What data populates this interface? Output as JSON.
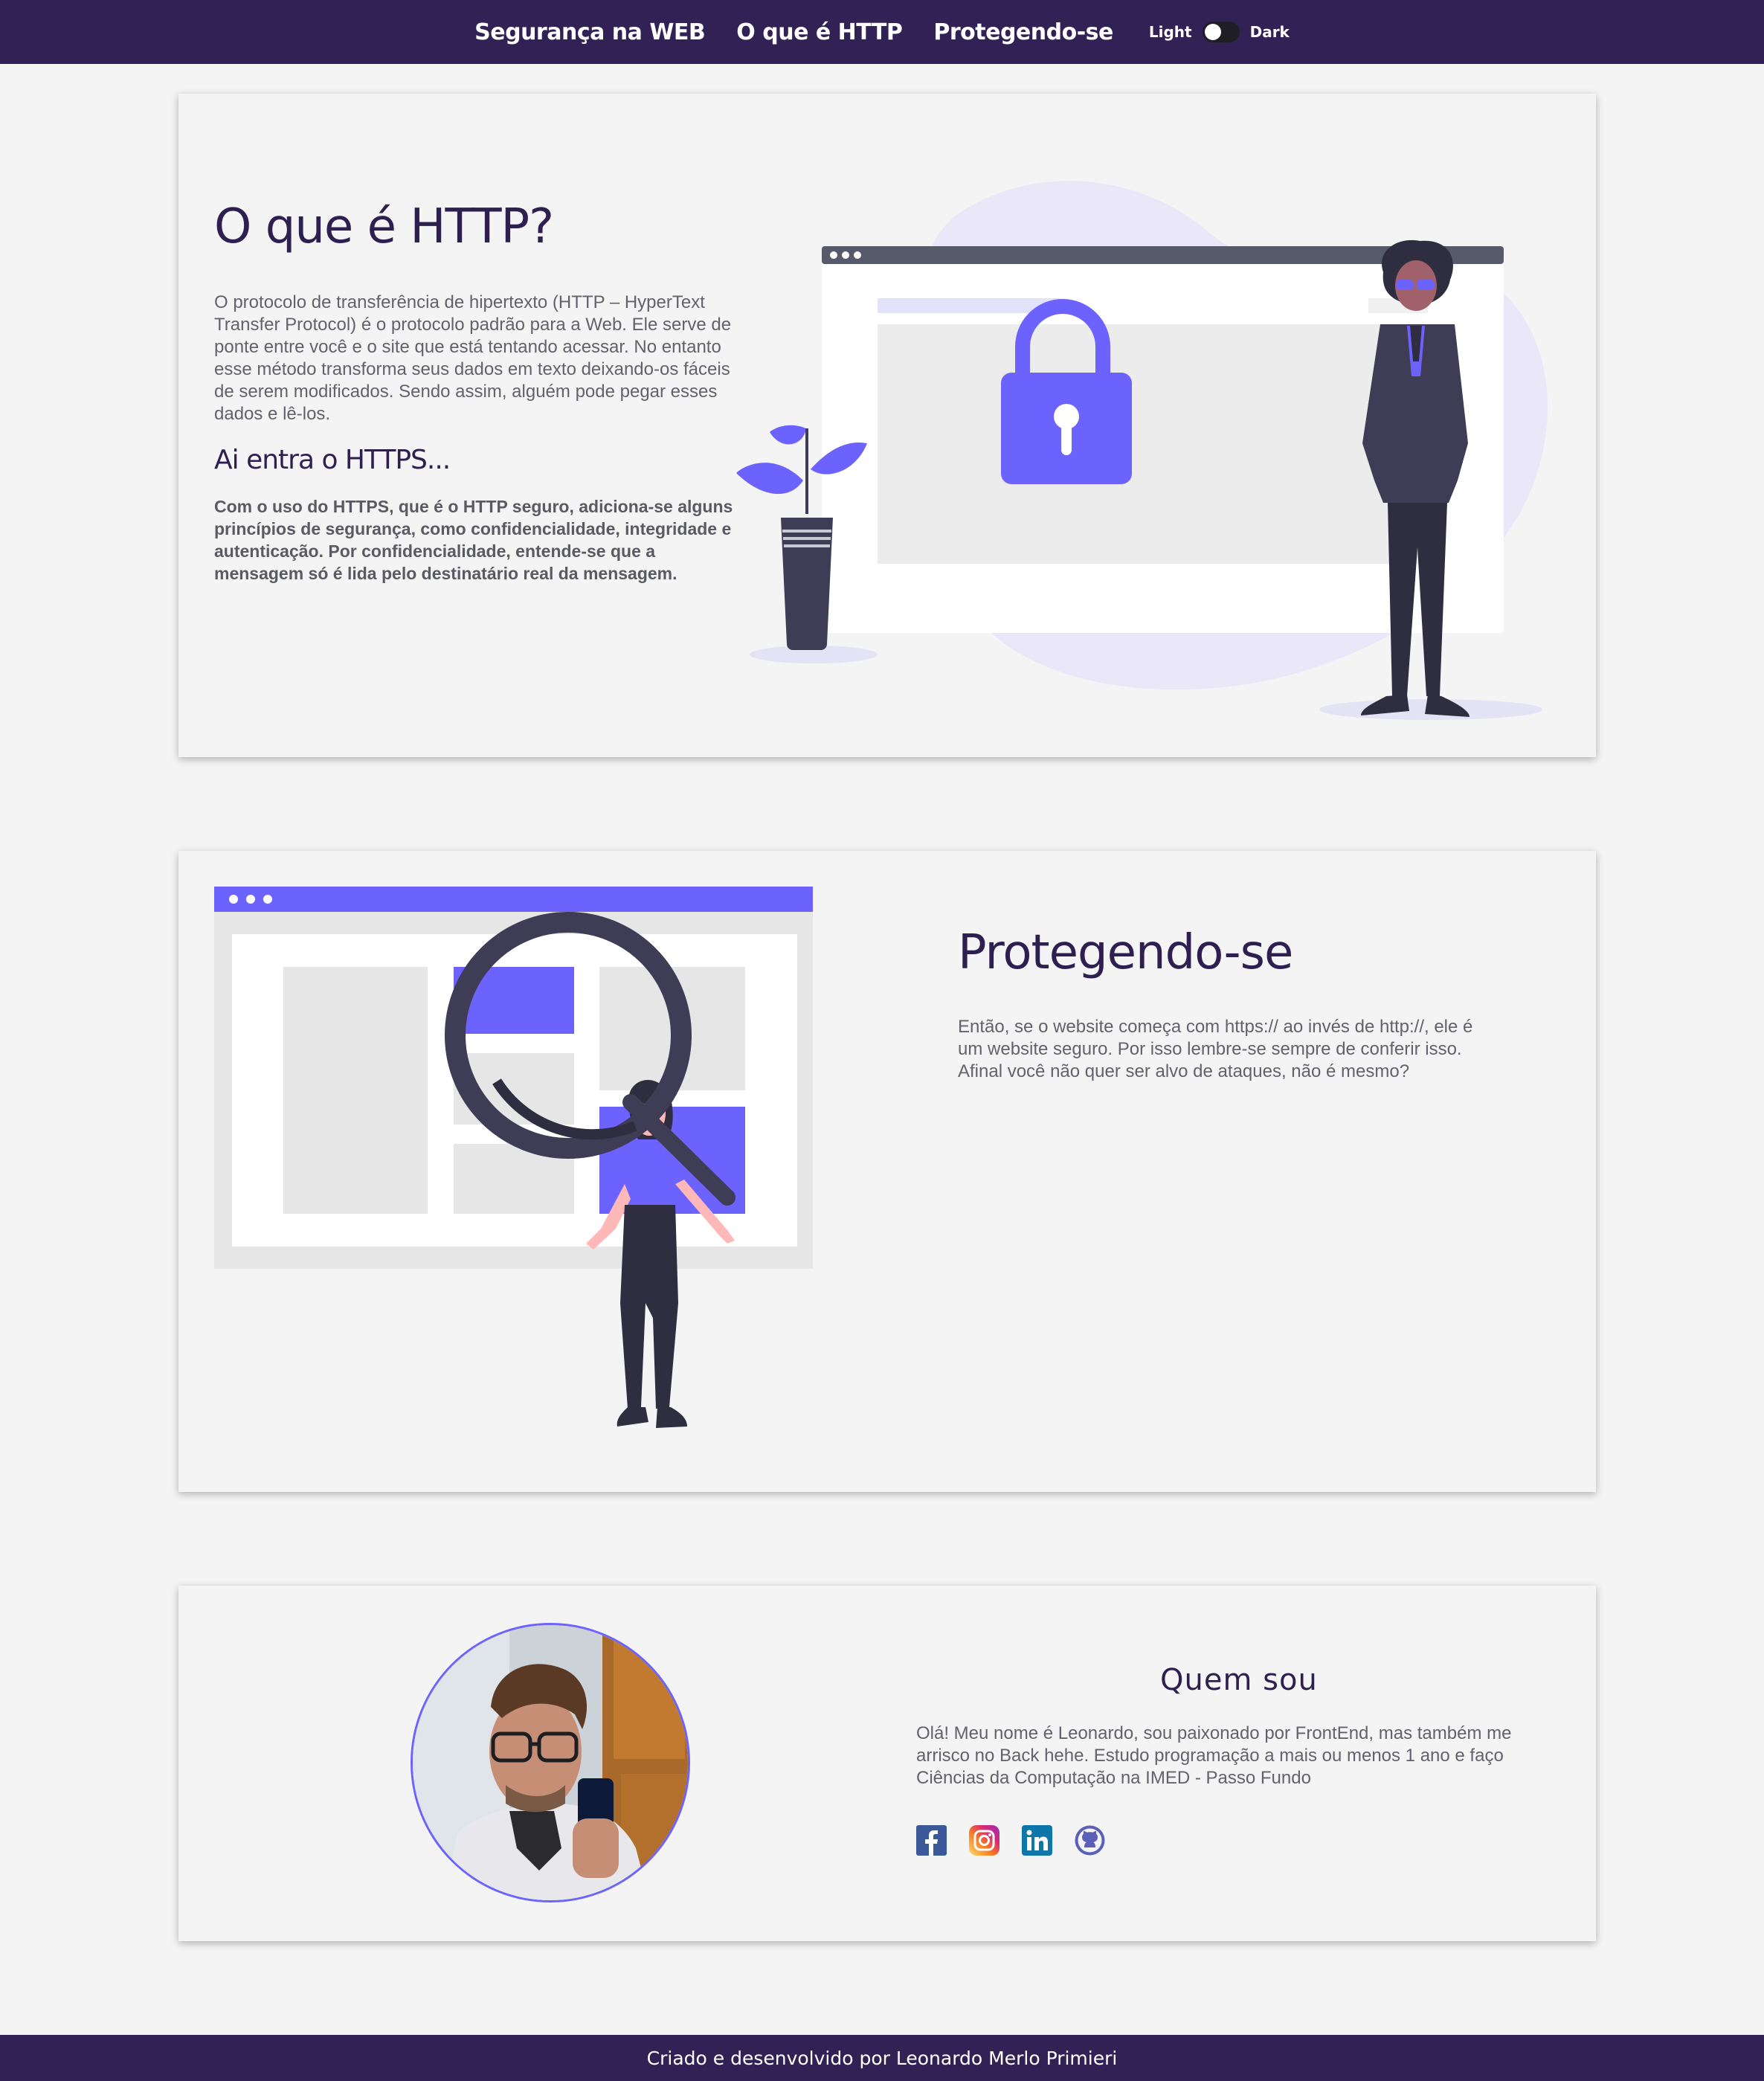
{
  "nav": {
    "links": [
      "Segurança na WEB",
      "O que é HTTP",
      "Protegendo-se"
    ],
    "toggle": {
      "light": "Light",
      "dark": "Dark"
    }
  },
  "http_section": {
    "title": "O que é HTTP?",
    "paragraph": "O protocolo de transferência de hipertexto (HTTP – HyperText Transfer Protocol) é o protocolo padrão para a Web. Ele serve de ponte entre você e o site que está tentando acessar. No entanto esse método transforma seus dados em texto deixando-os fáceis de serem modificados. Sendo assim, alguém pode pegar esses dados e lê-los.",
    "subtitle": "Ai entra o HTTPS...",
    "paragraph2": "Com o uso do HTTPS, que é o HTTP seguro, adiciona-se alguns princípios de segurança, como confidencialidade, integridade e autenticação. Por confidencialidade, entende-se que a mensagem só é lida pelo destinatário real da mensagem."
  },
  "protect_section": {
    "title": "Protegendo-se",
    "paragraph": "Então, se o website começa com https:// ao invés de http://, ele é um website seguro. Por isso lembre-se sempre de conferir isso. Afinal você não quer ser alvo de ataques, não é mesmo?"
  },
  "about_section": {
    "title": "Quem sou",
    "paragraph": "Olá! Meu nome é Leonardo, sou paixonado por FrontEnd, mas também me arrisco no Back hehe. Estudo programação a mais ou menos 1 ano e faço Ciências da Computação na IMED - Passo Fundo",
    "social_icons": [
      "facebook-icon",
      "instagram-icon",
      "linkedin-icon",
      "github-icon"
    ]
  },
  "footer": {
    "text": "Criado e desenvolvido por Leonardo Merlo Primieri"
  },
  "colors": {
    "brand": "#322154",
    "accent": "#6c63ff",
    "title": "#2d1f4f"
  }
}
